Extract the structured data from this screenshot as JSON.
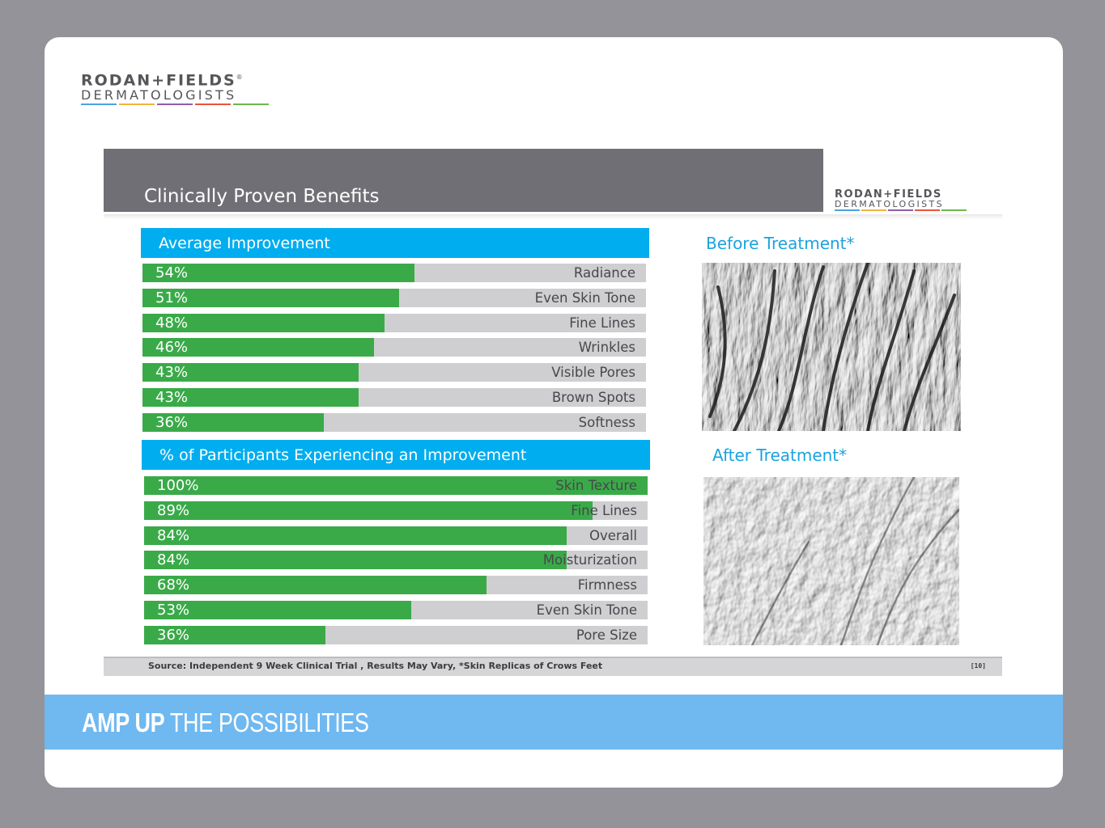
{
  "brand": {
    "name_line1": "RODAN+FIELDS",
    "registered": "®",
    "name_line2": "DERMATOLOGISTS",
    "stripe_colors": [
      "#4aa3df",
      "#f2b33d",
      "#8e5fa8",
      "#e8553d",
      "#6bb84a"
    ]
  },
  "slide": {
    "title": "Clinically Proven Benefits",
    "source": "Source: Independent 9 Week Clinical Trial , Results May Vary, *Skin Replicas of Crows Feet",
    "page": "[10]",
    "before_title": "Before Treatment*",
    "after_title": "After Treatment*"
  },
  "banner": {
    "bold": "AMP UP",
    "rest": " THE POSSIBILITIES"
  },
  "colors": {
    "bar_green": "#3aaa49",
    "bar_track": "#cfcfd1",
    "header_blue": "#00adef",
    "title_gray": "#706f75",
    "banner_blue": "#70b8f0"
  },
  "chart_data": [
    {
      "type": "bar",
      "title": "Average Improvement",
      "unit": "%",
      "xlim": [
        0,
        100
      ],
      "categories": [
        "Radiance",
        "Even Skin Tone",
        "Fine Lines",
        "Wrinkles",
        "Visible Pores",
        "Brown Spots",
        "Softness"
      ],
      "values": [
        54,
        51,
        48,
        46,
        43,
        43,
        36
      ],
      "labels": [
        "54%",
        "51%",
        "48%",
        "46%",
        "43%",
        "43%",
        "36%"
      ]
    },
    {
      "type": "bar",
      "title": "% of Participants Experiencing an Improvement",
      "unit": "%",
      "xlim": [
        0,
        100
      ],
      "categories": [
        "Skin Texture",
        "Fine Lines",
        "Overall",
        "Moisturization",
        "Firmness",
        "Even Skin Tone",
        "Pore Size"
      ],
      "values": [
        100,
        89,
        84,
        84,
        68,
        53,
        36
      ],
      "labels": [
        "100%",
        "89%",
        "84%",
        "84%",
        "68%",
        "53%",
        "36%"
      ]
    }
  ]
}
